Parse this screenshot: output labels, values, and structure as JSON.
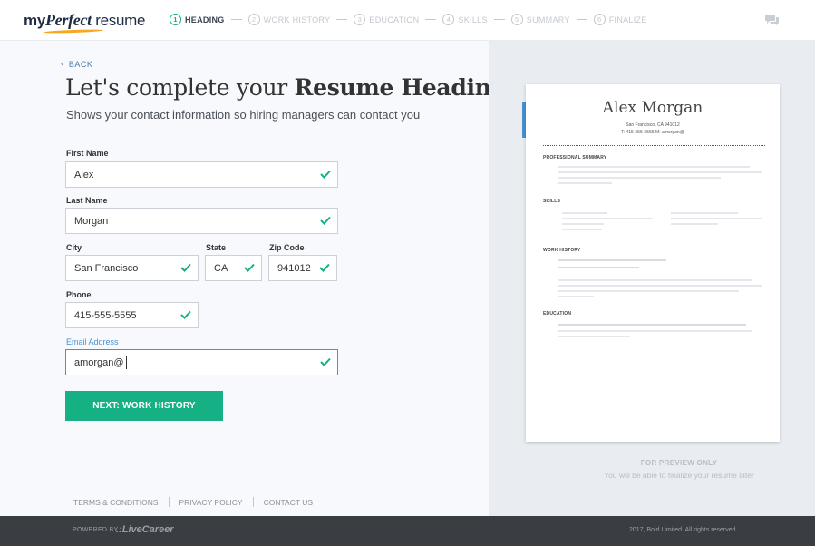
{
  "header": {
    "logo": {
      "my": "my",
      "perfect": "Perfect",
      "resume": " resume"
    },
    "steps": [
      {
        "num": "1",
        "label": "HEADING",
        "active": true
      },
      {
        "num": "2",
        "label": "WORK HISTORY",
        "active": false
      },
      {
        "num": "3",
        "label": "EDUCATION",
        "active": false
      },
      {
        "num": "4",
        "label": "SKILLS",
        "active": false
      },
      {
        "num": "5",
        "label": "SUMMARY",
        "active": false
      },
      {
        "num": "6",
        "label": "FINALIZE",
        "active": false
      }
    ],
    "chat_icon": "chat-bubbles-icon"
  },
  "form": {
    "back_label": "BACK",
    "title_prefix": "Let's complete your ",
    "title_bold": "Resume Heading",
    "subtitle": "Shows your contact information so hiring managers can contact you",
    "fields": {
      "first_name": {
        "label": "First Name",
        "value": "Alex"
      },
      "last_name": {
        "label": "Last Name",
        "value": "Morgan"
      },
      "city": {
        "label": "City",
        "value": "San Francisco"
      },
      "state": {
        "label": "State",
        "value": "CA"
      },
      "zip": {
        "label": "Zip Code",
        "value": "941012"
      },
      "phone": {
        "label": "Phone",
        "value": "415-555-5555"
      },
      "email": {
        "label": "Email Address",
        "value": "amorgan@"
      }
    },
    "next_button": "NEXT: WORK HISTORY"
  },
  "footer_links": [
    "TERMS & CONDITIONS",
    "PRIVACY POLICY",
    "CONTACT US"
  ],
  "preview": {
    "name": "Alex Morgan",
    "city_line": "San Francisco, CA 941012",
    "contact_line": "T: 415-555-5555 M: amorgan@",
    "sections": [
      "PROFESSIONAL SUMMARY",
      "SKILLS",
      "WORK HISTORY",
      "EDUCATION"
    ],
    "note_title": "FOR PREVIEW ONLY",
    "note_sub": "You will be able to finalize your resume later"
  },
  "bottom_bar": {
    "powered_by": "POWERED BY",
    "brand": ".:LiveCareer",
    "copyright": "2017, Bold Limited. All rights reserved."
  },
  "colors": {
    "accent_green": "#15b083",
    "focus_blue": "#4a90d0",
    "bottom_bar": "#3a3d42"
  }
}
